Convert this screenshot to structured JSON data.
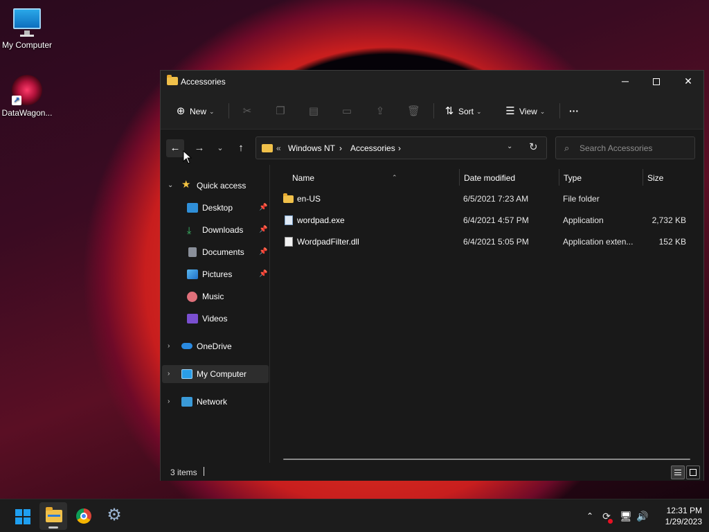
{
  "desktop": {
    "icons": [
      {
        "label": "My Computer",
        "icon": "monitor-icon"
      },
      {
        "label": "DataWagon...",
        "icon": "datawagon-shortcut-icon"
      }
    ]
  },
  "window": {
    "title": "Accessories",
    "controls": {
      "minimize": "─",
      "close": "✕"
    }
  },
  "commandbar": {
    "new_label": "New",
    "sort_label": "Sort",
    "view_label": "View",
    "more_label": "···"
  },
  "address": {
    "overflow": "«",
    "crumbs": [
      "Windows NT",
      "Accessories"
    ],
    "search_placeholder": "Search Accessories"
  },
  "nav": {
    "quick_access": "Quick access",
    "items": [
      "Desktop",
      "Downloads",
      "Documents",
      "Pictures",
      "Music",
      "Videos"
    ],
    "onedrive": "OneDrive",
    "my_computer": "My Computer",
    "network": "Network"
  },
  "columns": {
    "name": "Name",
    "date": "Date modified",
    "type": "Type",
    "size": "Size"
  },
  "files": [
    {
      "name": "en-US",
      "date": "6/5/2021 7:23 AM",
      "type": "File folder",
      "size": ""
    },
    {
      "name": "wordpad.exe",
      "date": "6/4/2021 4:57 PM",
      "type": "Application",
      "size": "2,732 KB"
    },
    {
      "name": "WordpadFilter.dll",
      "date": "6/4/2021 5:05 PM",
      "type": "Application exten...",
      "size": "152 KB"
    }
  ],
  "status": {
    "items": "3 items"
  },
  "taskbar": {
    "time": "12:31 PM",
    "date": "1/29/2023"
  },
  "colors": {
    "accent": "#1f9ff0",
    "folder": "#f0c04a",
    "window_bg": "#191919"
  }
}
